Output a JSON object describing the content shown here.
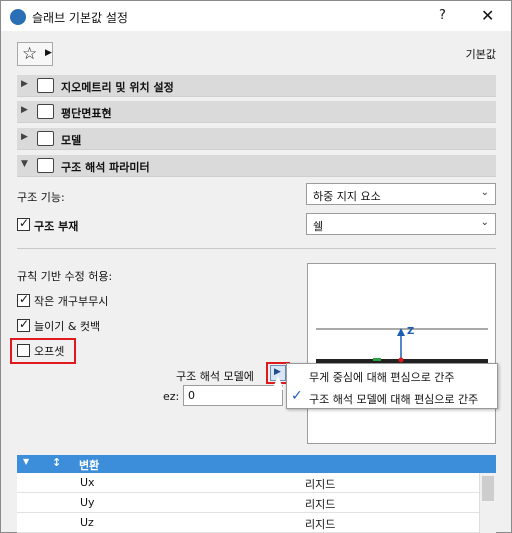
{
  "window": {
    "title": "슬래브 기본값 설정",
    "help": "?",
    "close": "✕"
  },
  "toolbar": {
    "preset_label": "기본값"
  },
  "panels": [
    {
      "label": "지오메트리 및 위치 설정",
      "expanded": false
    },
    {
      "label": "평단면표현",
      "expanded": false
    },
    {
      "label": "모델",
      "expanded": false
    },
    {
      "label": "구조 해석 파라미터",
      "expanded": true
    }
  ],
  "structural": {
    "function_label": "구조 기능:",
    "function_value": "하중 지지 요소",
    "member_label": "구조 부재",
    "member_checked": true,
    "member_value": "쉘",
    "rules_label": "규칙 기반 수정 허용:",
    "options": [
      {
        "label": "작은 개구부무시",
        "checked": true
      },
      {
        "label": "늘이기 & 컷백",
        "checked": true
      },
      {
        "label": "오프셋",
        "checked": false
      }
    ],
    "model_offset_label": "구조 해석 모델에",
    "ez_label": "ez:",
    "ez_value": "0",
    "axis_label": "Z"
  },
  "menu": {
    "items": [
      {
        "label": "무게 중심에 대해 편심으로 간주",
        "checked": false
      },
      {
        "label": "구조 해석 모델에 대해 편심으로 간주",
        "checked": true
      }
    ]
  },
  "table": {
    "header": "변환",
    "rows": [
      {
        "key": "Ux",
        "value": "리지드"
      },
      {
        "key": "Uy",
        "value": "리지드"
      },
      {
        "key": "Uz",
        "value": "리지드"
      }
    ]
  },
  "colors": {
    "accent": "#3c8edb",
    "highlight": "#e0191e",
    "axis": "#1a5fb4"
  }
}
